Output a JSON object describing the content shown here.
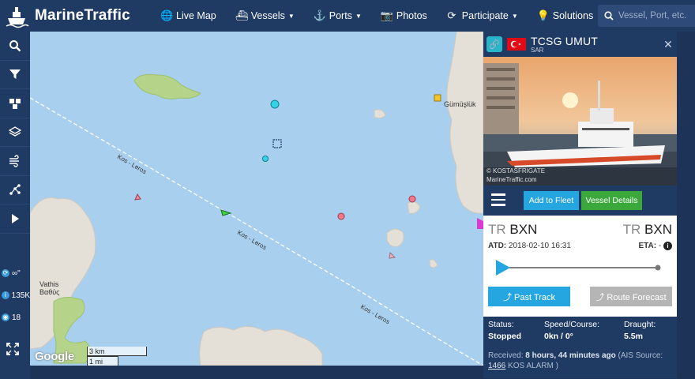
{
  "brand": {
    "name": "MarineTraffic"
  },
  "nav": {
    "live_map": "Live Map",
    "vessels": "Vessels",
    "ports": "Ports",
    "photos": "Photos",
    "participate": "Participate",
    "solutions": "Solutions"
  },
  "search": {
    "placeholder": "Vessel, Port, etc."
  },
  "sidebar": {
    "stats": {
      "infinity": "∞\"",
      "count_1": "135K",
      "count_2": "18"
    }
  },
  "map": {
    "lane_label": "Kos - Leros",
    "places": {
      "gumusluk": "Gümüşlük",
      "vathis_1": "Vathis",
      "vathis_2": "Βαθύς"
    },
    "scale_km": "3 km",
    "scale_mi": "1 mi",
    "attribution": "Google"
  },
  "vessel": {
    "name": "TCSG UMUT",
    "type": "SAR",
    "photo_credit_1": "© KOSTASFRIGATE",
    "photo_credit_2": "MarineTraffic.com",
    "add_to_fleet": "Add to Fleet",
    "vessel_details": "Vessel Details",
    "from_cc": "TR",
    "from_code": "BXN",
    "to_cc": "TR",
    "to_code": "BXN",
    "atd_label": "ATD:",
    "atd_value": "2018-02-10 16:31",
    "eta_label": "ETA:",
    "eta_value": "-",
    "past_track": "Past Track",
    "route_forecast": "Route Forecast",
    "status_label": "Status:",
    "status_value": "Stopped",
    "speed_label": "Speed/Course:",
    "speed_value": "0kn / 0°",
    "draught_label": "Draught:",
    "draught_value": "5.5m",
    "received_prefix": "Received:",
    "received_time": "8 hours, 44 minutes ago",
    "source_prefix": "(AIS Source:",
    "source_id": "1466",
    "source_name": "KOS ALARM )"
  },
  "colors": {
    "nav_bg": "#1f3a63",
    "sea": "#a8d0ee",
    "accent_blue": "#26a6e0",
    "accent_green": "#3aa83a",
    "flag_red": "#e30a17"
  }
}
